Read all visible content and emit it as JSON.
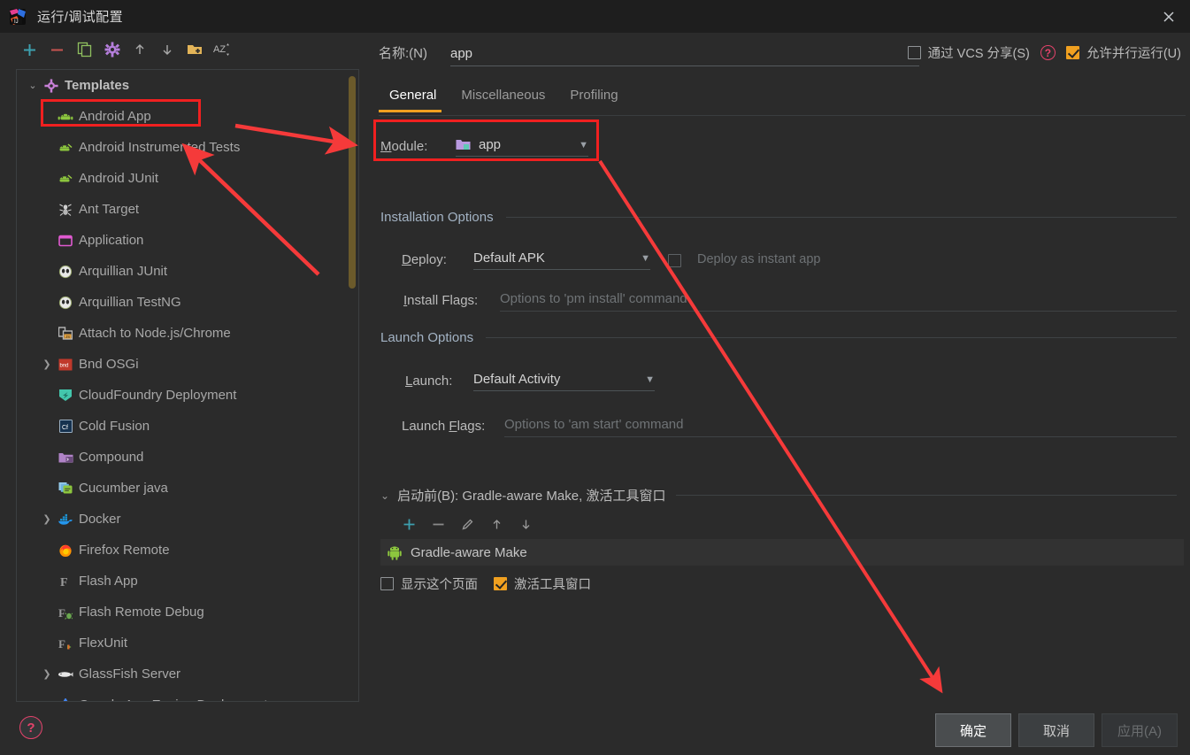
{
  "window": {
    "title": "运行/调试配置",
    "close_label": "✕",
    "app_icon": "intellij-idea-icon"
  },
  "toolbar": {
    "buttons": [
      {
        "name": "add-button",
        "glyph": "+",
        "color": "#3d9fae"
      },
      {
        "name": "remove-button",
        "glyph": "−",
        "color": "#c75450"
      },
      {
        "name": "copy-configuration-button",
        "glyph": "copy-icon",
        "color": "#8fbf5f"
      },
      {
        "name": "edit-templates-button",
        "glyph": "gear-icon",
        "color": "#b57edc"
      },
      {
        "name": "move-up-button",
        "glyph": "↑",
        "color": "#a9a9a9"
      },
      {
        "name": "move-down-button",
        "glyph": "↓",
        "color": "#a9a9a9"
      },
      {
        "name": "new-folder-button",
        "glyph": "folder-plus-icon",
        "color": "#e3b458"
      },
      {
        "name": "sort-alphabetically-button",
        "glyph": "AZ",
        "color": "#b8b8b8"
      }
    ]
  },
  "tree": {
    "root": {
      "label": "Templates",
      "icon": "gear-icon",
      "expanded": true
    },
    "items": [
      {
        "label": "Android App",
        "icon": "android-head-icon",
        "expandable": false,
        "highlighted": true
      },
      {
        "label": "Android Instrumented Tests",
        "icon": "android-tests-icon",
        "expandable": false
      },
      {
        "label": "Android JUnit",
        "icon": "android-tests-icon",
        "expandable": false
      },
      {
        "label": "Ant Target",
        "icon": "ant-icon",
        "expandable": false
      },
      {
        "label": "Application",
        "icon": "application-window-icon",
        "expandable": false
      },
      {
        "label": "Arquillian JUnit",
        "icon": "arquillian-icon",
        "expandable": false
      },
      {
        "label": "Arquillian TestNG",
        "icon": "arquillian-icon",
        "expandable": false
      },
      {
        "label": "Attach to Node.js/Chrome",
        "icon": "nodejs-attach-icon",
        "expandable": false
      },
      {
        "label": "Bnd OSGi",
        "icon": "bnd-icon",
        "expandable": true
      },
      {
        "label": "CloudFoundry Deployment",
        "icon": "cloudfoundry-icon",
        "expandable": false
      },
      {
        "label": "Cold Fusion",
        "icon": "coldfusion-icon",
        "expandable": false
      },
      {
        "label": "Compound",
        "icon": "compound-icon",
        "expandable": false
      },
      {
        "label": "Cucumber java",
        "icon": "cucumber-icon",
        "expandable": false
      },
      {
        "label": "Docker",
        "icon": "docker-icon",
        "expandable": true
      },
      {
        "label": "Firefox Remote",
        "icon": "firefox-icon",
        "expandable": false
      },
      {
        "label": "Flash App",
        "icon": "flash-icon",
        "expandable": false
      },
      {
        "label": "Flash Remote Debug",
        "icon": "flash-debug-icon",
        "expandable": false
      },
      {
        "label": "FlexUnit",
        "icon": "flexunit-icon",
        "expandable": false
      },
      {
        "label": "GlassFish Server",
        "icon": "glassfish-icon",
        "expandable": true
      },
      {
        "label": "Google App Engine Deployment",
        "icon": "google-appengine-icon",
        "expandable": false
      }
    ]
  },
  "config": {
    "name_label": "名称:(N)",
    "name_value": "app",
    "share_checkbox": {
      "label": "通过 VCS 分享(S)",
      "checked": false
    },
    "parallel_checkbox": {
      "label": "允许并行运行(U)",
      "checked": true
    },
    "help_glyph": "?",
    "tabs": [
      {
        "label": "General",
        "active": true
      },
      {
        "label": "Miscellaneous",
        "active": false
      },
      {
        "label": "Profiling",
        "active": false
      }
    ],
    "module": {
      "label": "Module:",
      "label_accel": "M",
      "value": "app",
      "icon": "module-folder-icon",
      "arrow": "▼"
    },
    "installation_options": {
      "section_title": "Installation Options",
      "deploy": {
        "label": "Deploy:",
        "label_accel": "D",
        "value": "Default APK",
        "arrow": "▼"
      },
      "instant_app": {
        "label": "Deploy as instant app",
        "checked": false,
        "disabled": true
      },
      "install_flags": {
        "label": "Install Flags:",
        "label_accel": "I",
        "placeholder": "Options to 'pm install' command",
        "value": ""
      }
    },
    "launch_options": {
      "section_title": "Launch Options",
      "launch": {
        "label": "Launch:",
        "label_accel": "L",
        "value": "Default Activity",
        "arrow": "▼"
      },
      "launch_flags": {
        "label": "Launch Flags:",
        "label_accel": "F",
        "placeholder": "Options to 'am start' command",
        "value": ""
      }
    },
    "before_launch": {
      "header": "启动前(B): Gradle-aware Make, 激活工具窗口",
      "twisty": "⌄",
      "mini_toolbar": [
        {
          "name": "add-task-button",
          "glyph": "+",
          "color": "#3d9fae"
        },
        {
          "name": "remove-task-button",
          "glyph": "−",
          "color": "#8a8a8a"
        },
        {
          "name": "edit-task-button",
          "glyph": "pencil-icon",
          "color": "#9a9a9a"
        },
        {
          "name": "move-task-up-button",
          "glyph": "↑",
          "color": "#9a9a9a"
        },
        {
          "name": "move-task-down-button",
          "glyph": "↓",
          "color": "#9a9a9a"
        }
      ],
      "tasks": [
        {
          "label": "Gradle-aware Make",
          "icon": "android-robot-icon"
        }
      ],
      "show_page_checkbox": {
        "label": "显示这个页面",
        "checked": false
      },
      "activate_tool_window_checkbox": {
        "label": "激活工具窗口",
        "checked": true
      }
    }
  },
  "footer": {
    "help_glyph": "?",
    "buttons": [
      {
        "label": "确定",
        "style": "primary",
        "name": "ok-button"
      },
      {
        "label": "取消",
        "style": "normal",
        "name": "cancel-button"
      },
      {
        "label": "应用(A)",
        "style": "disabled",
        "name": "apply-button"
      }
    ]
  },
  "colors": {
    "accent_orange": "#f0a020",
    "annotation_red": "#f02020",
    "help_pink": "#e5436b",
    "bg": "#2b2b2b",
    "titlebar_bg": "#1e1e1e"
  }
}
